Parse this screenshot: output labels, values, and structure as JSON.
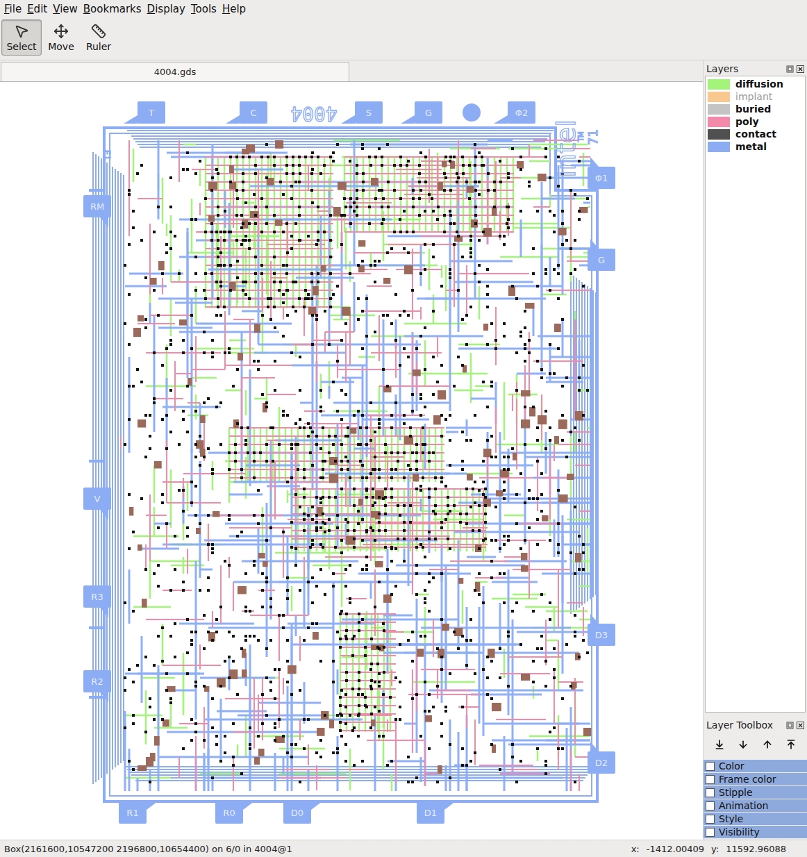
{
  "menu": [
    "File",
    "Edit",
    "View",
    "Bookmarks",
    "Display",
    "Tools",
    "Help"
  ],
  "toolbar": [
    {
      "label": "Select",
      "selected": true
    },
    {
      "label": "Move",
      "selected": false
    },
    {
      "label": "Ruler",
      "selected": false
    }
  ],
  "tabs": [
    {
      "label": "4004.gds",
      "selected": true
    }
  ],
  "layout": {
    "title": "4004",
    "logo": "intel",
    "trademark": "TM",
    "year": "71",
    "mark": "F1",
    "pads": [
      {
        "label": "T"
      },
      {
        "label": "C"
      },
      {
        "label": "S"
      },
      {
        "label": "G"
      },
      {
        "label": "Φ2"
      },
      {
        "label": "Φ1"
      },
      {
        "label": "G"
      },
      {
        "label": "RM"
      },
      {
        "label": "V"
      },
      {
        "label": "R3"
      },
      {
        "label": "R2"
      },
      {
        "label": "R1"
      },
      {
        "label": "R0"
      },
      {
        "label": "D0"
      },
      {
        "label": "D1"
      },
      {
        "label": "D3"
      },
      {
        "label": "D2"
      }
    ]
  },
  "layers_panel": {
    "title": "Layers",
    "layers": [
      {
        "name": "diffusion",
        "color": "#a4f47c",
        "visible": true
      },
      {
        "name": "implant",
        "color": "#f8c890",
        "visible": false
      },
      {
        "name": "buried",
        "color": "#c4c4c4",
        "visible": true
      },
      {
        "name": "poly",
        "color": "#f48aaa",
        "visible": true
      },
      {
        "name": "contact",
        "color": "#505050",
        "visible": true
      },
      {
        "name": "metal",
        "color": "#8cacf4",
        "visible": true
      }
    ]
  },
  "layer_toolbox": {
    "title": "Layer Toolbox",
    "sections": [
      {
        "label": "Color",
        "checked": false
      },
      {
        "label": "Frame color",
        "checked": false
      },
      {
        "label": "Stipple",
        "checked": false
      },
      {
        "label": "Animation",
        "checked": false
      },
      {
        "label": "Style",
        "checked": false
      },
      {
        "label": "Visibility",
        "checked": false
      }
    ]
  },
  "status_bar": {
    "selection": "Box(2161600,10547200 2196800,10654400) on 6/0 in 4004@1",
    "x_label": "x:",
    "x": "-1412.00409",
    "y_label": "y:",
    "y": "11592.96088"
  }
}
